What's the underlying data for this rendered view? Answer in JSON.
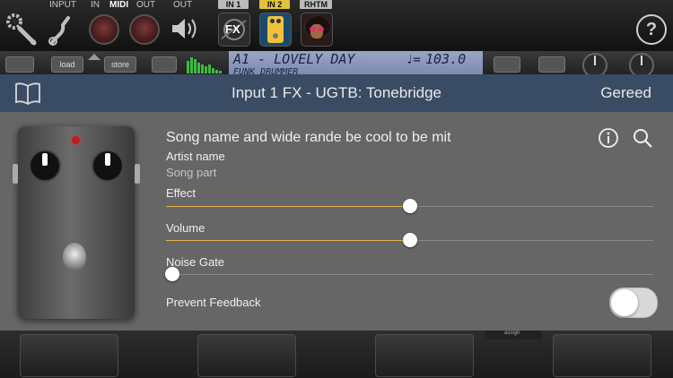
{
  "topbar": {
    "input_label": "INPUT",
    "in_label": "IN",
    "midi_label": "MIDI",
    "out_label": "OUT",
    "out2_label": "OUT",
    "in1_tag": "IN 1",
    "in2_tag": "IN 2",
    "rhtm_tag": "RHTM",
    "fx_text": "FX",
    "help_symbol": "?"
  },
  "strip": {
    "load_label": "load",
    "store_label": "store",
    "lcd_line1": "A1 - LOVELY DAY",
    "lcd_line2": "FUNK DRUMMER",
    "tempo": "103.0"
  },
  "panel": {
    "title": "Input 1 FX - UGTB: Tonebridge",
    "done_label": "Gereed",
    "song_name": "Song name and wide rande be cool to be mit",
    "artist_name": "Artist name",
    "song_part": "Song part",
    "effect_label": "Effect",
    "effect_value": 0.5,
    "volume_label": "Volume",
    "volume_value": 0.5,
    "noise_gate_label": "Noise Gate",
    "noise_gate_value": 0.0,
    "prevent_feedback_label": "Prevent Feedback",
    "prevent_feedback_on": false
  },
  "bottom": {
    "assign_label": "assign"
  },
  "colors": {
    "header_bg": "#3a4c63",
    "panel_bg": "#666666",
    "slider_fill": "#e0b64a"
  }
}
